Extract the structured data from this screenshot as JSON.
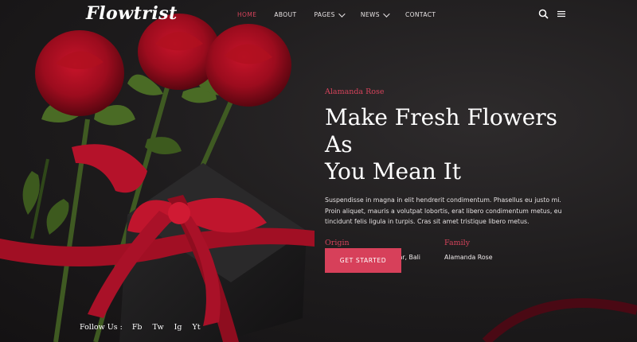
{
  "brand": {
    "logo": "Flowtrist"
  },
  "nav": {
    "items": [
      {
        "label": "HOME",
        "active": true,
        "dropdown": false
      },
      {
        "label": "ABOUT",
        "active": false,
        "dropdown": false
      },
      {
        "label": "PAGES",
        "active": false,
        "dropdown": true
      },
      {
        "label": "NEWS",
        "active": false,
        "dropdown": true
      },
      {
        "label": "CONTACT",
        "active": false,
        "dropdown": false
      }
    ],
    "icons": [
      "search-icon",
      "menu-icon"
    ]
  },
  "hero": {
    "subtitle": "Alamanda Rose",
    "title_line1": "Make Fresh Flowers As",
    "title_line2": "You Mean It",
    "description": "Suspendisse in magna in elit hendrerit condimentum. Phasellus eu justo mi. Proin aliquet, mauris a volutpat lobortis, erat libero condimentum metus, eu tincidunt felis ligula in turpis. Cras sit amet tristique libero metus.",
    "origin_label": "Origin",
    "origin_value": "Seroja ST. 4421 Denpasar, Bali",
    "family_label": "Family",
    "family_value": "Alamanda Rose",
    "cta_label": "GET STARTED"
  },
  "social": {
    "label": "Follow Us :",
    "links": [
      "Fb",
      "Tw",
      "Ig",
      "Yt"
    ]
  },
  "colors": {
    "accent": "#d7405a",
    "background": "#1e1c1d",
    "text": "#ffffff"
  }
}
